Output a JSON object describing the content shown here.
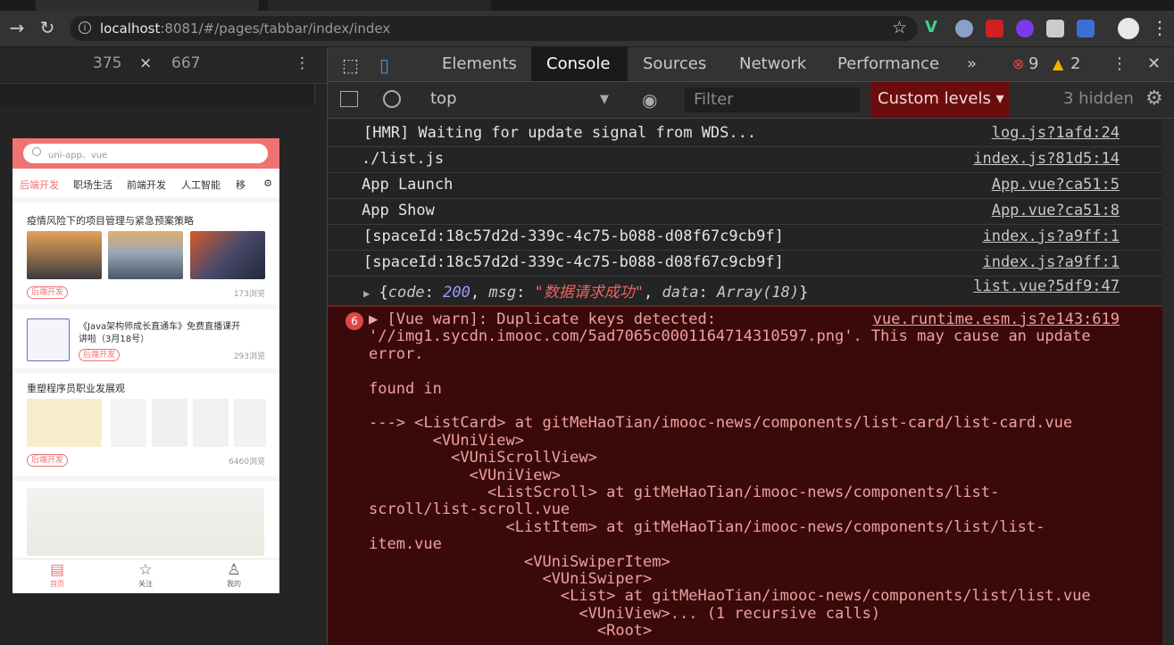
{
  "browser": {
    "url_host": "localhost",
    "url_rest": ":8081/#/pages/tabbar/index/index"
  },
  "device": {
    "width": "375",
    "times": "×",
    "height": "667"
  },
  "app": {
    "search_placeholder": "uni-app、vue",
    "tabs": [
      "后端开发",
      "职场生活",
      "前端开发",
      "人工智能",
      "移"
    ],
    "cards": [
      {
        "title": "疫情风险下的项目管理与紧急预案策略",
        "tag": "后端开发",
        "views": "173浏览"
      },
      {
        "title": "《Java架构师成长直通车》免费直播课开",
        "title2": "讲啦（3月18号）",
        "tag": "后端开发",
        "views": "293浏览"
      },
      {
        "title": "重塑程序员职业发展观",
        "tag": "后端开发",
        "views": "6460浏览"
      }
    ],
    "tabbar": [
      {
        "label": "首页",
        "icon": "document-icon"
      },
      {
        "label": "关注",
        "icon": "star-icon"
      },
      {
        "label": "我的",
        "icon": "user-icon"
      }
    ]
  },
  "devtools": {
    "tabs": [
      "Elements",
      "Console",
      "Sources",
      "Network",
      "Performance"
    ],
    "more": "»",
    "error_count": "9",
    "warning_count": "2",
    "context": "top",
    "filter_placeholder": "Filter",
    "levels_label": "Custom levels ▾",
    "hidden_label": "3 hidden",
    "logs": [
      {
        "msg": "[HMR] Waiting for update signal from WDS...",
        "src": "log.js?1afd:24"
      },
      {
        "msg": "./list.js",
        "src": "index.js?81d5:14"
      },
      {
        "msg": "App Launch",
        "src": "App.vue?ca51:5"
      },
      {
        "msg": "App Show",
        "src": "App.vue?ca51:8"
      },
      {
        "msg": "[spaceId:18c57d2d-339c-4c75-b088-d08f67c9cb9f]",
        "src": "index.js?a9ff:1"
      },
      {
        "msg": "[spaceId:18c57d2d-339c-4c75-b088-d08f67c9cb9f]",
        "src": "index.js?a9ff:1"
      }
    ],
    "object_log": {
      "k1": "code",
      "v1": "200",
      "k2": "msg",
      "v2": "\"数据请求成功\"",
      "k3": "data",
      "v3": "Array(18)",
      "src": "list.vue?5df9:47"
    },
    "error": {
      "count": "6",
      "src": "vue.runtime.esm.js?e143:619",
      "lines": [
        "▶ [Vue warn]: Duplicate keys detected:",
        "'//img1.sycdn.imooc.com/5ad7065c0001164714310597.png'. This may cause an update",
        "error.",
        "",
        "found in",
        "",
        "---> <ListCard> at gitMeHaoTian/imooc-news/components/list-card/list-card.vue",
        "       <VUniView>",
        "         <VUniScrollView>",
        "           <VUniView>",
        "             <ListScroll> at gitMeHaoTian/imooc-news/components/list-",
        "scroll/list-scroll.vue",
        "               <ListItem> at gitMeHaoTian/imooc-news/components/list/list-",
        "item.vue",
        "                 <VUniSwiperItem>",
        "                   <VUniSwiper>",
        "                     <List> at gitMeHaoTian/imooc-news/components/list/list.vue",
        "                       <VUniView>... (1 recursive calls)",
        "                         <Root>"
      ]
    }
  }
}
